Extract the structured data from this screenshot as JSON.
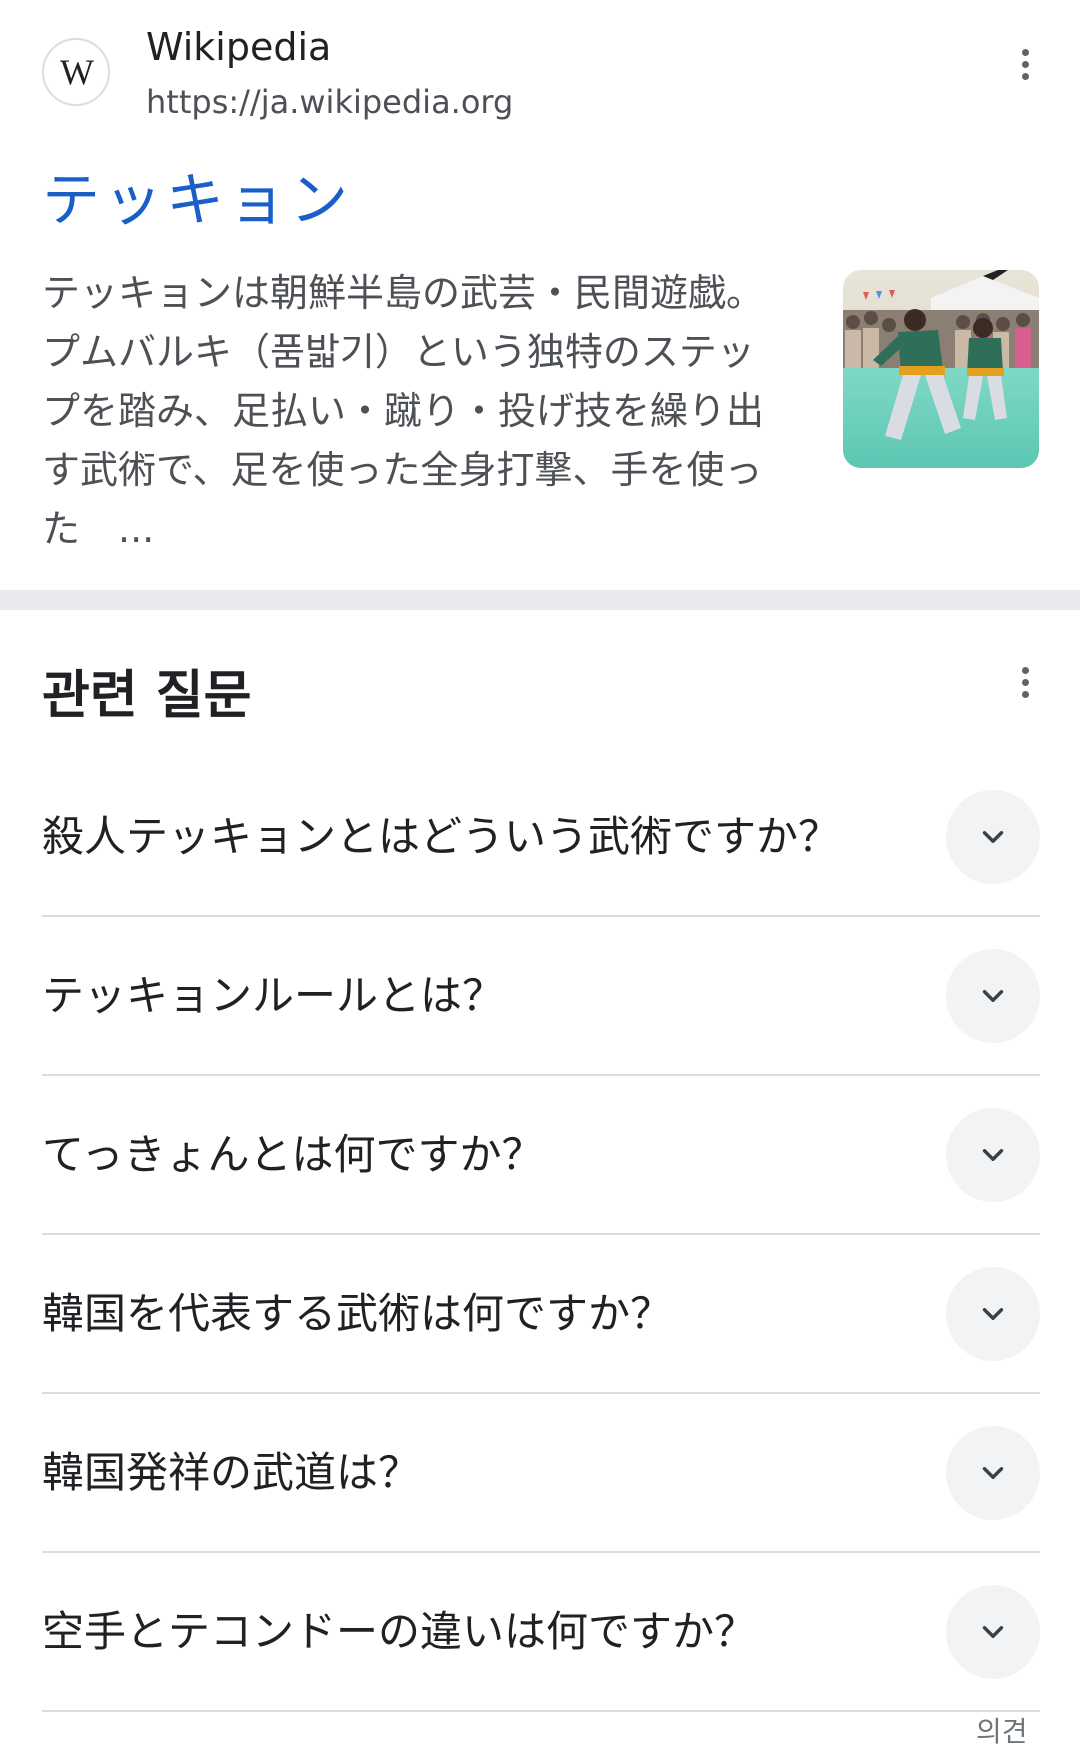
{
  "result": {
    "site_name": "Wikipedia",
    "url": "https://ja.wikipedia.org",
    "logo_letter": "W",
    "title": "テッキョン",
    "snippet": "テッキョンは朝鮮半島の武芸・民間遊戯。プムバルキ（품밟기）という独特のステップを踏み、足払い・蹴り・投げ技を繰り出す武術で、足を使った全身打撃、手を使った　...",
    "thumbnail_icon": "taekkyeon-demonstration-photo",
    "menu_icon": "more-vert-icon"
  },
  "related_questions": {
    "title": "관련 질문",
    "menu_icon": "more-vert-icon",
    "items": [
      {
        "question": "殺人テッキョンとはどういう武術ですか？"
      },
      {
        "question": "テッキョンルールとは？"
      },
      {
        "question": "てっきょんとは何ですか？"
      },
      {
        "question": "韓国を代表する武術は何ですか？"
      },
      {
        "question": "韓国発祥の武道は？"
      },
      {
        "question": "空手とテコンドーの違いは何ですか？"
      }
    ],
    "toggle_icon": "chevron-down-icon"
  },
  "footer": {
    "partial_text": "의견"
  },
  "colors": {
    "title_link": "#1a5fc8",
    "text_primary": "#202124",
    "text_secondary": "#4d5156",
    "divider": "#dadce0",
    "band": "#e8eaed",
    "toggle_bg": "#f1f3f4"
  }
}
